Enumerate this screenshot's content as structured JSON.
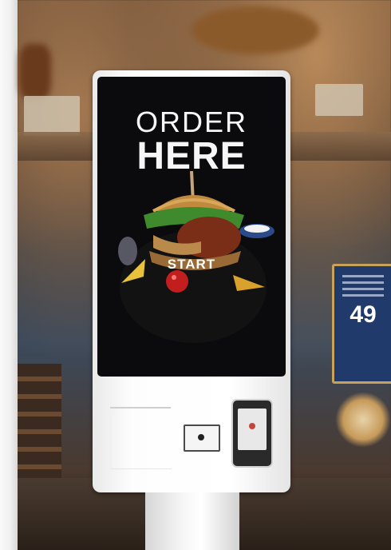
{
  "kiosk": {
    "headline_line1": "ORDER",
    "headline_line2": "HERE",
    "start_button_label": "START"
  },
  "poster": {
    "number": "49"
  },
  "colors": {
    "screen_background": "#0b0b0d",
    "kiosk_body": "#ffffff",
    "poster_background": "#203a6b"
  }
}
